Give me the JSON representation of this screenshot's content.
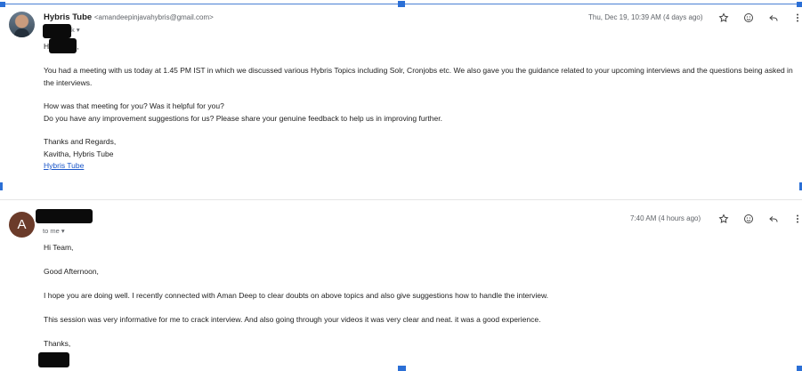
{
  "message1": {
    "sender_name": "Hybris Tube",
    "sender_email": "<amandeepinjavahybris@gmail.com>",
    "to_suffix": "k",
    "time": "Thu, Dec 19, 10:39 AM (4 days ago)",
    "greeting_prefix": "H",
    "greeting_suffix": ",",
    "para1": "You had a meeting with us today at 1.45 PM IST in which we discussed various Hybris Topics including Solr, Cronjobs etc. We also gave you the guidance related to your upcoming interviews and the questions being asked in the interviews.",
    "q1": "How was that meeting for you? Was it helpful for you?",
    "q2": "Do you have any improvement suggestions for us? Please share your genuine feedback to help us in improving further.",
    "sign1": "Thanks and Regards,",
    "sign2": "Kavitha, Hybris Tube",
    "sign_link": "Hybris Tube"
  },
  "message2": {
    "avatar_letter": "A",
    "to_label": "to me",
    "time": "7:40 AM (4 hours ago)",
    "l1": "Hi Team,",
    "l2": "Good Afternoon,",
    "l3": "I hope you are doing well. I recently connected with Aman Deep to clear doubts on above topics and also give suggestions how to handle the interview.",
    "l4": "This session was very informative for me to crack interview. And also going through your videos it was very clear and neat. it was a good experience.",
    "l5": "Thanks,"
  },
  "icons": [
    "star-icon",
    "emoji-icon",
    "reply-icon",
    "more-vert-icon"
  ],
  "colors": {
    "accent_selection": "#2b6fd6",
    "link": "#1a56c9",
    "avatar_letter_bg": "#6b3b2a"
  }
}
